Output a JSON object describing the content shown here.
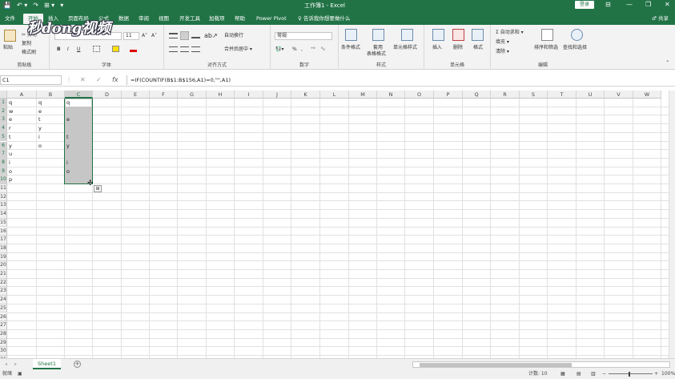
{
  "titlebar": {
    "title": "工作簿1  -  Excel",
    "login": "登录",
    "qat": [
      "💾",
      "↶ ▾",
      "↷",
      "⊞ ▾",
      "▾"
    ],
    "controls": [
      "⊟",
      "—",
      "❐",
      "✕"
    ]
  },
  "tabs": [
    "文件",
    "开始",
    "插入",
    "页面布局",
    "公式",
    "数据",
    "审阅",
    "视图",
    "开发工具",
    "加载项",
    "帮助",
    "Power Pivot",
    "♀ 告诉我你想要做什么"
  ],
  "share": "♂ 共享",
  "ribbon": {
    "clipboard": {
      "paste": "粘贴",
      "cut": "✂ 剪切",
      "copy": "复制",
      "format_painter": "格式刷",
      "label": "剪贴板"
    },
    "font": {
      "name": "",
      "size": "11",
      "grow": "A˄",
      "shrink": "A˅",
      "bold": "B",
      "italic": "I",
      "underline": "U",
      "label": "字体"
    },
    "alignment": {
      "wrap": "自动换行",
      "merge": "合并后居中 ▾",
      "label": "对齐方式"
    },
    "number": {
      "format": "常规",
      "label": "数字"
    },
    "styles": {
      "conditional": "条件格式",
      "table1": "套用",
      "table2": "表格格式",
      "cell": "单元格样式",
      "label": "样式"
    },
    "cells": {
      "insert": "插入",
      "delete": "删除",
      "format": "格式",
      "label": "单元格"
    },
    "editing": {
      "autosum": "Σ 自动求和 ▾",
      "fill": "填充 ▾",
      "clear": "清除 ▾",
      "sort": "排序和筛选",
      "find": "查找和选择",
      "label": "编辑"
    }
  },
  "watermark": "秒dong视频",
  "formula_bar": {
    "name_box": "C1",
    "fx": "fx",
    "formula": "=IF(COUNTIF(B$1:B$156,A1)=0,\"\",A1)"
  },
  "columns": [
    "A",
    "B",
    "C",
    "D",
    "E",
    "F",
    "G",
    "H",
    "I",
    "J",
    "K",
    "L",
    "M",
    "N",
    "O",
    "P",
    "Q",
    "R",
    "S",
    "T",
    "U",
    "V",
    "W"
  ],
  "rows": [
    "1",
    "2",
    "3",
    "4",
    "5",
    "6",
    "7",
    "8",
    "9",
    "10",
    "11",
    "12",
    "13",
    "14",
    "15",
    "16",
    "17",
    "18",
    "19",
    "20",
    "21",
    "22",
    "23",
    "24",
    "25",
    "26",
    "27",
    "28",
    "29",
    "30",
    "31"
  ],
  "cells": {
    "A": [
      "q",
      "w",
      "e",
      "r",
      "t",
      "y",
      "u",
      "i",
      "o",
      "p"
    ],
    "B": [
      "q",
      "e",
      "t",
      "y",
      "i",
      "o",
      "",
      "",
      "",
      ""
    ],
    "C": [
      "q",
      "",
      "e",
      "",
      "t",
      "y",
      "",
      "i",
      "o",
      ""
    ]
  },
  "selection": {
    "active": "C1",
    "range": "C1:C10"
  },
  "sheet_tabs": [
    "Sheet1"
  ],
  "add_sheet": "+",
  "status": {
    "mode": "就绪",
    "count": "计数: 10",
    "zoom": "100%"
  },
  "colors": {
    "accent": "#217346",
    "selection": "#c6c6c6"
  }
}
